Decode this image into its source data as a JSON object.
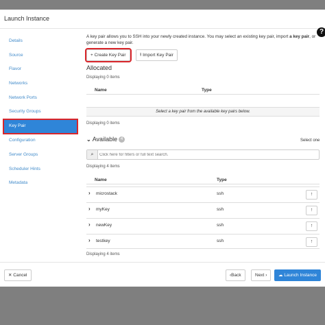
{
  "modal": {
    "title": "Launch Instance",
    "help_glyph": "?"
  },
  "sidebar": {
    "items": [
      {
        "label": "Details"
      },
      {
        "label": "Source"
      },
      {
        "label": "Flavor"
      },
      {
        "label": "Networks"
      },
      {
        "label": "Network Ports"
      },
      {
        "label": "Security Groups"
      },
      {
        "label": "Key Pair"
      },
      {
        "label": "Configuration"
      },
      {
        "label": "Server Groups"
      },
      {
        "label": "Scheduler Hints"
      },
      {
        "label": "Metadata"
      }
    ],
    "active": "Key Pair"
  },
  "intro": {
    "p1": "A key pair allows you to SSH into your newly created instance. You may select an existing key pair, import ",
    "b1": "a key pair",
    "p2": ", or generate a new key pair."
  },
  "actions": {
    "create": "Create Key Pair",
    "import": "Import Key Pair"
  },
  "allocated": {
    "title": "Allocated",
    "displaying": "Displaying 0 items",
    "col_name": "Name",
    "col_type": "Type",
    "empty": "Select a key pair from the available key pairs below.",
    "displaying_bottom": "Displaying 0 items"
  },
  "available": {
    "title": "Available",
    "count": "4",
    "select_one": "Select one",
    "search_placeholder": "Click here for filters or full text search.",
    "displaying": "Displaying 4 items",
    "col_name": "Name",
    "col_type": "Type",
    "rows": [
      {
        "name": "microstack",
        "type": "ssh"
      },
      {
        "name": "myKey",
        "type": "ssh"
      },
      {
        "name": "newKey",
        "type": "ssh"
      },
      {
        "name": "testkey",
        "type": "ssh"
      }
    ],
    "displaying_bottom": "Displaying 4 items"
  },
  "footer": {
    "cancel": "Cancel",
    "back": "Back",
    "next": "Next",
    "launch": "Launch Instance"
  }
}
